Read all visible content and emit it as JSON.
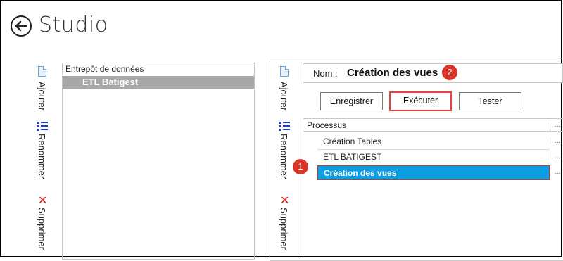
{
  "app": {
    "title": "Studio",
    "back_icon": "back-arrow-icon"
  },
  "toolbar": {
    "add_label": "Ajouter",
    "rename_label": "Renommer",
    "delete_label": "Supprimer",
    "add_icon": "document-icon",
    "rename_icon": "list-icon",
    "delete_icon": "x-icon"
  },
  "warehouse_panel": {
    "header": "Entrepôt de données",
    "selected_item": "ETL Batigest"
  },
  "process_panel": {
    "nom_label": "Nom :",
    "nom_value": "Création des vues",
    "badge_2": "2",
    "buttons": {
      "save": "Enregistrer",
      "execute": "Exécuter",
      "test": "Tester"
    },
    "grid": {
      "header": "Processus",
      "dots": "...",
      "rows": [
        "Création Tables",
        "ETL BATIGEST",
        "Création des vues"
      ]
    },
    "badge_1": "1"
  },
  "colors": {
    "selection": "#0a9fe0",
    "accent_red": "#d9332a",
    "selected_item_bg": "#a8a8a8"
  }
}
